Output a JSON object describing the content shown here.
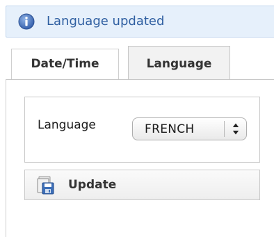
{
  "notice": {
    "icon": "info-icon",
    "text": "Language updated"
  },
  "tabs": [
    {
      "label": "Date/Time",
      "selected": false
    },
    {
      "label": "Language",
      "selected": true
    }
  ],
  "form": {
    "language_label": "Language",
    "language_select": {
      "value": "FRENCH"
    }
  },
  "update_button": {
    "icon": "save-icon",
    "label": "Update"
  }
}
